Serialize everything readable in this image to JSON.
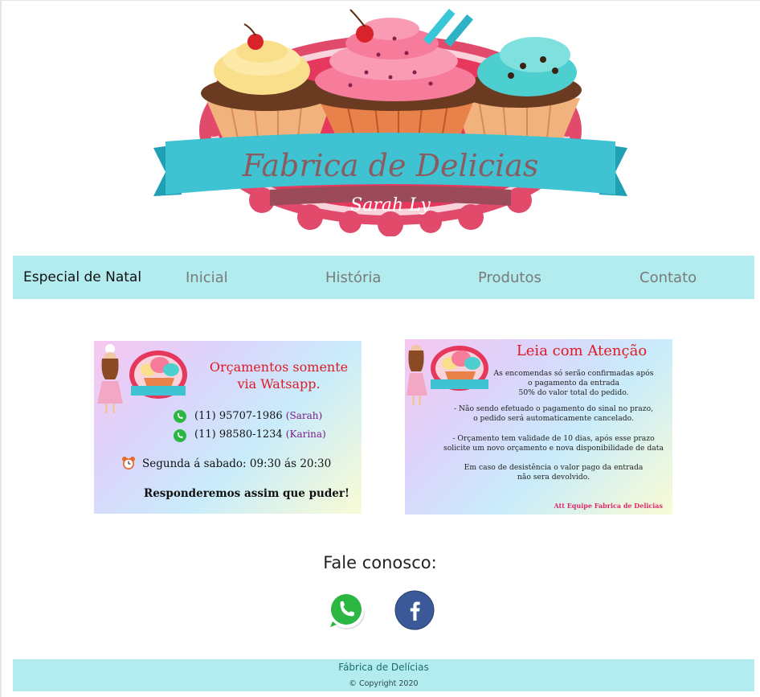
{
  "logo": {
    "title": "Fabrica de Delicias",
    "subtitle": "Sarah  Ly"
  },
  "navbar": {
    "brand": "Especial de Natal",
    "links": [
      "Inicial",
      "História",
      "Produtos",
      "Contato"
    ]
  },
  "card_left": {
    "title_line1": "Orçamentos somente",
    "title_line2": "via Watsapp.",
    "phone1": "(11) 95707-1986",
    "phone1_name": "(Sarah)",
    "phone2": "(11) 98580-1234",
    "phone2_name": "(Karina)",
    "hours": "Segunda á sabado: 09:30 ás 20:30",
    "reply": "Responderemos assim que puder!"
  },
  "card_right": {
    "title": "Leia com Atenção",
    "p1_l1": "As  encomendas só serão confirmadas após",
    "p1_l2": "o pagamento da entrada",
    "p1_l3": "50% do valor total do pedido.",
    "p2_l1": "- Não sendo efetuado o pagamento do sinal no prazo,",
    "p2_l2": "o pedido será automaticamente cancelado.",
    "p3_l1": "- Orçamento tem validade de 10 dias, após esse prazo",
    "p3_l2": "solicite um novo orçamento e nova disponibilidade de data",
    "p4_l1": "Em caso de desistência o valor pago da entrada",
    "p4_l2": "não sera devolvido.",
    "signature": "Att Equipe Fabrica de Delicias"
  },
  "contact": {
    "title": "Fale conosco:"
  },
  "footer": {
    "name": "Fábrica de Delícias",
    "copyright": "© Copyright 2020"
  },
  "icons": {
    "whatsapp": "whatsapp-icon",
    "facebook": "facebook-icon",
    "clock": "alarm-clock-icon"
  },
  "colors": {
    "navbar_bg": "#b2ecee",
    "accent_red": "#e01a22",
    "whatsapp_green": "#2cb742",
    "facebook_blue": "#3b5998"
  }
}
